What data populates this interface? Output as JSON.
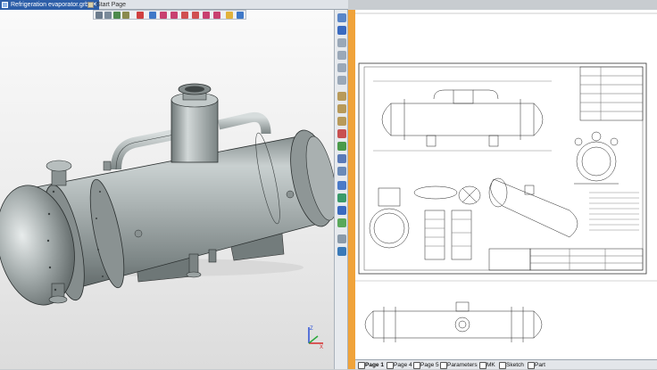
{
  "window": {
    "tabs": [
      {
        "label": "Refrigeration evaporator.grb",
        "active": true
      },
      {
        "label": "Start Page",
        "active": false
      }
    ]
  },
  "page_tabs": [
    {
      "label": "Page 1",
      "active": true
    },
    {
      "label": "Page 4",
      "active": false
    },
    {
      "label": "Page 5",
      "active": false
    },
    {
      "label": "Parameters",
      "active": false
    },
    {
      "label": "MK",
      "active": false
    },
    {
      "label": "Sketch",
      "active": false
    },
    {
      "label": "Part",
      "active": false
    }
  ],
  "axes": {
    "x": "X",
    "y": "Y",
    "z": "Z"
  },
  "colors": {
    "accent": "#2c5ea8",
    "splitter": "#f0a33a",
    "model": "#9da5a5",
    "axis_x": "#d62a2a",
    "axis_y": "#2aa83a",
    "axis_z": "#2a4fd6"
  },
  "icons": {
    "view_toolbar": [
      "zoom-icon",
      "pan-icon",
      "rotate-icon",
      "fit-icon",
      "select-icon",
      "box-icon",
      "sphere-icon",
      "cylinder-icon",
      "cone-icon",
      "torus-icon",
      "cube-icon",
      "render-icon"
    ],
    "side_toolbar": [
      "pointer-icon",
      "magnet-icon",
      "zoom-in-icon",
      "zoom-out-icon",
      "zoom-window-icon",
      "zoom-fit-icon",
      "view-3d-icon",
      "view-front-icon",
      "view-top-icon",
      "view-left-icon",
      "shade-icon",
      "wire-icon",
      "section-icon",
      "camera-icon",
      "light-icon",
      "material-icon",
      "layer-icon",
      "measure-icon",
      "snap-icon"
    ]
  }
}
